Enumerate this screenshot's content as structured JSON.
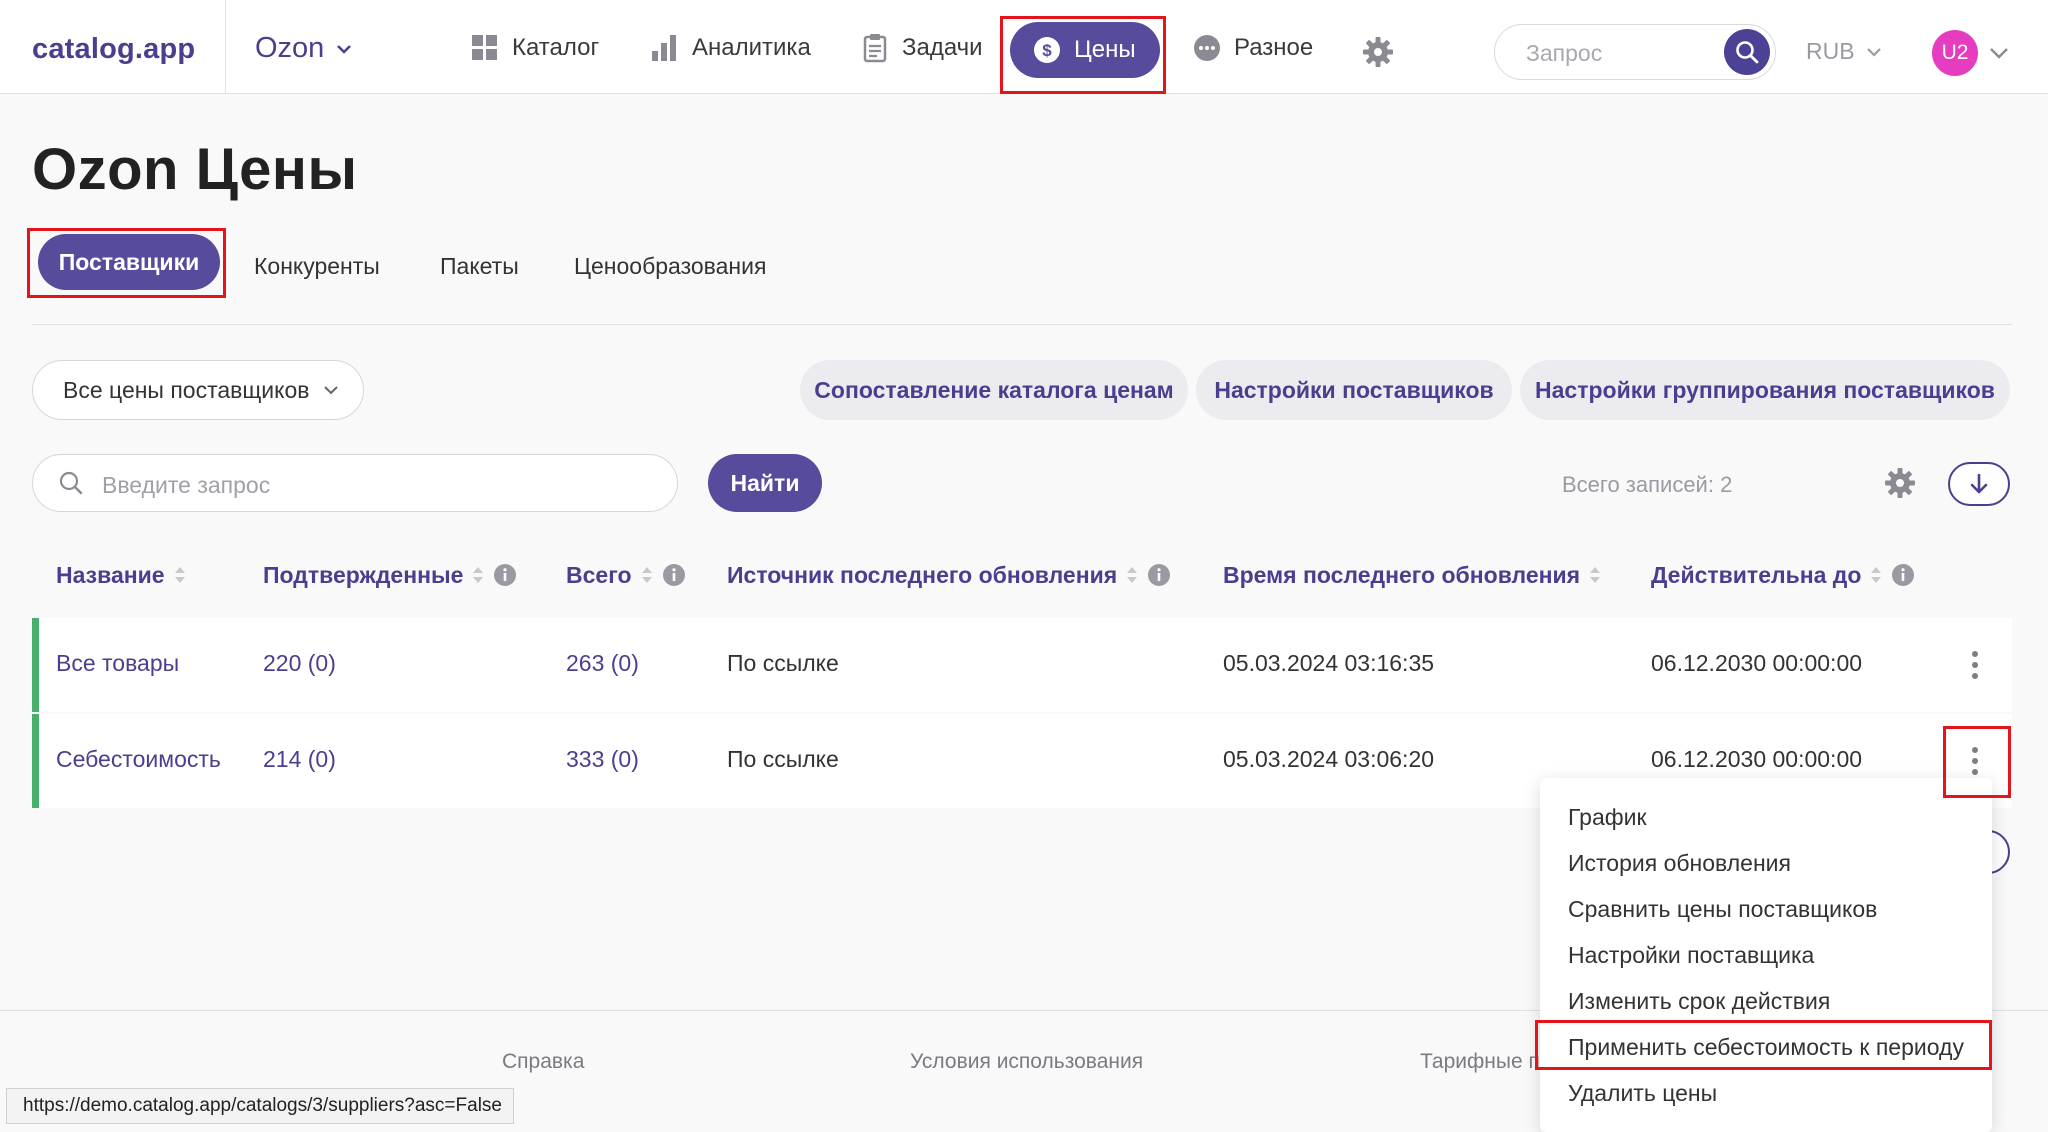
{
  "header": {
    "logo": "catalog.app",
    "store": "Ozon",
    "nav": {
      "catalog": "Каталог",
      "analytics": "Аналитика",
      "tasks": "Задачи",
      "prices": "Цены",
      "misc": "Разное"
    },
    "search_placeholder": "Запрос",
    "currency": "RUB",
    "avatar": "U2"
  },
  "page": {
    "title": "Ozon Цены",
    "tabs": {
      "suppliers": "Поставщики",
      "competitors": "Конкуренты",
      "packages": "Пакеты",
      "pricing": "Ценообразования"
    }
  },
  "filters": {
    "select_value": "Все цены поставщиков",
    "btn_catalog_mapping": "Сопоставление каталога ценам",
    "btn_supplier_settings": "Настройки поставщиков",
    "btn_grouping_settings": "Настройки группирования поставщиков"
  },
  "search": {
    "placeholder": "Введите запрос",
    "button": "Найти",
    "total_records": "Всего записей: 2"
  },
  "table": {
    "columns": {
      "name": "Название",
      "confirmed": "Подтвержденные",
      "total": "Всего",
      "source": "Источник последнего обновления",
      "updated": "Время последнего обновления",
      "valid_until": "Действительна до"
    },
    "rows": [
      {
        "name": "Все товары",
        "confirmed": "220 (0)",
        "total": "263 (0)",
        "source": "По ссылке",
        "updated": "05.03.2024 03:16:35",
        "valid_until": "06.12.2030 00:00:00"
      },
      {
        "name": "Себестоимость",
        "confirmed": "214 (0)",
        "total": "333 (0)",
        "source": "По ссылке",
        "updated": "05.03.2024 03:06:20",
        "valid_until": "06.12.2030 00:00:00"
      }
    ]
  },
  "menu": {
    "items": [
      "График",
      "История обновления",
      "Сравнить цены поставщиков",
      "Настройки поставщика",
      "Изменить срок действия",
      "Применить себестоимость к периоду",
      "Удалить цены"
    ]
  },
  "footer": {
    "help": "Справка",
    "terms": "Условия использования",
    "tariffs": "Тарифные п",
    "status_url": "https://demo.catalog.app/catalogs/3/suppliers?asc=False"
  },
  "colors": {
    "brand": "#574b9c",
    "accent_text": "#4a3f8f",
    "row_marker": "#48b06c",
    "highlight": "#e4141b",
    "avatar": "#e63cc0"
  }
}
